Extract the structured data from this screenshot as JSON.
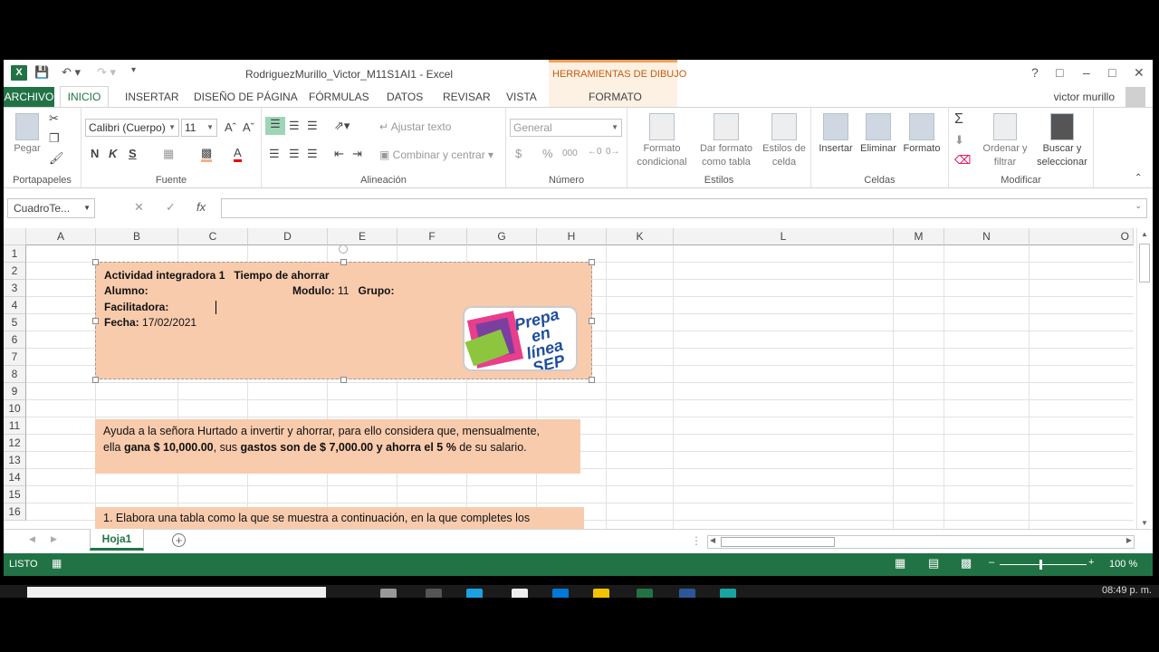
{
  "window_title": "RodriguezMurillo_Victor_M11S1AI1 - Excel",
  "contextual_tab": {
    "group": "HERRAMIENTAS DE DIBUJO",
    "tab": "FORMATO"
  },
  "user": "victor murillo",
  "tabs": [
    "ARCHIVO",
    "INICIO",
    "INSERTAR",
    "DISEÑO DE PÁGINA",
    "FÓRMULAS",
    "DATOS",
    "REVISAR",
    "VISTA"
  ],
  "ribbon": {
    "clipboard": {
      "paste": "Pegar",
      "label": "Portapapeles"
    },
    "font": {
      "name": "Calibri (Cuerpo)",
      "size": "11",
      "bold": "N",
      "italic": "K",
      "underline": "S",
      "label": "Fuente"
    },
    "alignment": {
      "wrap": "Ajustar texto",
      "merge": "Combinar y centrar",
      "label": "Alineación"
    },
    "number": {
      "format": "General",
      "currency": "$",
      "percent": "%",
      "comma": "000",
      "label": "Número"
    },
    "styles": {
      "conditional": [
        "Formato",
        "condicional"
      ],
      "table": [
        "Dar formato",
        "como tabla"
      ],
      "cell": [
        "Estilos de",
        "celda"
      ],
      "label": "Estilos"
    },
    "cells": {
      "insert": "Insertar",
      "delete": "Eliminar",
      "format": "Formato",
      "label": "Celdas"
    },
    "editing": {
      "sort": [
        "Ordenar y",
        "filtrar"
      ],
      "find": [
        "Buscar y",
        "seleccionar"
      ],
      "label": "Modificar"
    }
  },
  "namebox": "CuadroTe...",
  "columns": [
    "A",
    "B",
    "C",
    "D",
    "E",
    "F",
    "G",
    "H",
    "K",
    "L",
    "M",
    "N",
    "O"
  ],
  "rows": [
    "1",
    "2",
    "3",
    "4",
    "5",
    "6",
    "7",
    "8",
    "9",
    "10",
    "11",
    "12",
    "13",
    "14",
    "15",
    "16"
  ],
  "textbox1": {
    "title_a": "Actividad integradora 1",
    "title_b": "Tiempo de ahorrar",
    "alumno": "Alumno:",
    "modulo_label": "Modulo:",
    "modulo_value": "11",
    "grupo": "Grupo:",
    "facilitadora": "Facilitadora:",
    "fecha_label": "Fecha:",
    "fecha_value": "17/02/2021"
  },
  "logo": {
    "line1": "Prepa en",
    "line2": "línea",
    "line3": "SEP"
  },
  "textbox2": {
    "p1": "Ayuda a la señora Hurtado a invertir y ahorrar, para ello considera que, mensualmente,",
    "p2a": "ella ",
    "p2b": "gana $ 10,000.00",
    "p2c": ", sus ",
    "p2d": "gastos son de $ 7,000.00 y ahorra el 5 %",
    "p2e": " de su salario."
  },
  "textbox3": "1.  Elabora una tabla como la que se muestra a continuación, en la que completes los",
  "sheet_tab": "Hoja1",
  "status": {
    "mode": "LISTO",
    "zoom": "100 %"
  },
  "taskbar": {
    "clock": "08:49 p. m."
  }
}
